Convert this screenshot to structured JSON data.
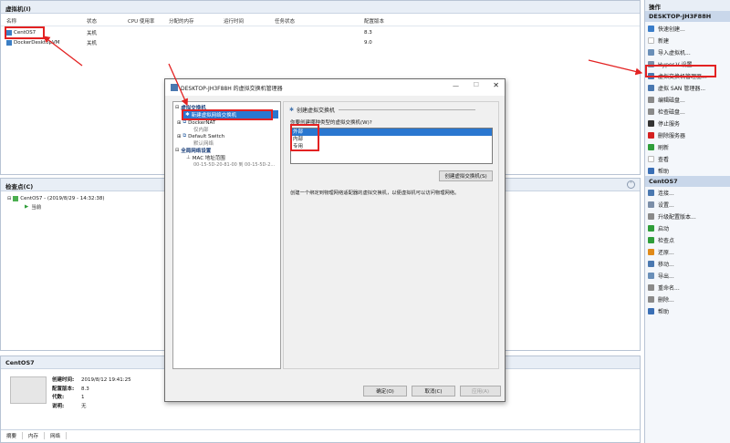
{
  "vm_pane": {
    "title": "虚拟机(I)",
    "columns": [
      "名称",
      "状态",
      "CPU 使用率",
      "分配的内存",
      "运行时间",
      "任务状态",
      "配置版本"
    ],
    "rows": [
      {
        "name": "CentOS7",
        "state": "关机",
        "version": "8.3"
      },
      {
        "name": "DockerDesktopVM",
        "state": "关机",
        "version": "9.0"
      }
    ]
  },
  "checkpoint_pane": {
    "title": "检查点(C)",
    "entry": "CentOS7 - (2019/8/29 - 14:32:38)",
    "current": "当前"
  },
  "details_pane": {
    "title": "CentOS7",
    "fields": [
      {
        "label": "创建时间:",
        "value": "2019/8/12 19:41:25"
      },
      {
        "label": "配置版本:",
        "value": "8.3"
      },
      {
        "label": "代数:",
        "value": "1"
      },
      {
        "label": "说明:",
        "value": "无"
      }
    ],
    "tabs": [
      "摘要",
      "内存",
      "网络"
    ]
  },
  "actions_pane": {
    "title": "操作",
    "host_section": "DESKTOP-JH3F88H",
    "host_actions": [
      {
        "label": "快速创建...",
        "icon": "quick-create-icon",
        "color": "#3a7dc9"
      },
      {
        "label": "新建",
        "icon": "new-icon",
        "color": "#ffffff"
      },
      {
        "label": "导入虚拟机...",
        "icon": "import-icon",
        "color": "#6a8fb8"
      },
      {
        "label": "Hyper-V 设置...",
        "icon": "settings-icon",
        "color": "#7b8ea8"
      },
      {
        "label": "虚拟交换机管理器...",
        "icon": "switch-manager-icon",
        "color": "#4a78b0"
      },
      {
        "label": "虚拟 SAN 管理器...",
        "icon": "san-manager-icon",
        "color": "#4a78b0"
      },
      {
        "label": "编辑磁盘...",
        "icon": "edit-disk-icon",
        "color": "#8a8a8a"
      },
      {
        "label": "检查磁盘...",
        "icon": "inspect-disk-icon",
        "color": "#8a8a8a"
      },
      {
        "label": "停止服务",
        "icon": "stop-service-icon",
        "color": "#333333"
      },
      {
        "label": "删除服务器",
        "icon": "delete-server-icon",
        "color": "#d42020"
      },
      {
        "label": "刷新",
        "icon": "refresh-icon",
        "color": "#2f9e3a"
      },
      {
        "label": "查看",
        "icon": "view-icon",
        "color": "#ffffff"
      },
      {
        "label": "帮助",
        "icon": "help-icon",
        "color": "#3a6fb5"
      }
    ],
    "vm_section": "CentOS7",
    "vm_actions": [
      {
        "label": "连接...",
        "icon": "connect-icon",
        "color": "#4a78b0"
      },
      {
        "label": "设置...",
        "icon": "vm-settings-icon",
        "color": "#7b8ea8"
      },
      {
        "label": "升级配置版本...",
        "icon": "upgrade-icon",
        "color": "#8a8a8a"
      },
      {
        "label": "启动",
        "icon": "start-icon",
        "color": "#2f9e3a"
      },
      {
        "label": "检查点",
        "icon": "checkpoint-icon",
        "color": "#2f9e3a"
      },
      {
        "label": "还原...",
        "icon": "revert-icon",
        "color": "#e08a1a"
      },
      {
        "label": "移动...",
        "icon": "move-icon",
        "color": "#4a78b0"
      },
      {
        "label": "导出...",
        "icon": "export-icon",
        "color": "#6a8fb8"
      },
      {
        "label": "重命名...",
        "icon": "rename-icon",
        "color": "#8a8a8a"
      },
      {
        "label": "删除...",
        "icon": "delete-icon",
        "color": "#8a8a8a"
      },
      {
        "label": "帮助",
        "icon": "help-icon",
        "color": "#3a6fb5"
      }
    ]
  },
  "dialog": {
    "title": "DESKTOP-JH3F88H 的虚拟交换机管理器",
    "tree": {
      "section_switches": "虚拟交换机",
      "create_item": "新建虚拟网络交换机",
      "docker_nat": "DockerNAT",
      "docker_nat_sub": "仅内部",
      "default_switch": "Default Switch",
      "default_switch_sub": "默认网络",
      "section_global": "全局网络设置",
      "mac_range": "MAC 地址范围",
      "mac_range_sub": "00-15-5D-20-81-00 到 00-15-5D-2..."
    },
    "panel_title": "创建虚拟交换机",
    "prompt": "你要创建哪种类型的虚拟交换机(W)?",
    "switch_types": [
      "外部",
      "内部",
      "专用"
    ],
    "selected_type": "外部",
    "create_button": "创建虚拟交换机(S)",
    "description": "创建一个绑定到物理网络适配器的虚拟交换机，以便虚拟机可以访问物理网络。",
    "ok": "确定(O)",
    "cancel": "取消(C)",
    "apply": "应用(A)"
  }
}
